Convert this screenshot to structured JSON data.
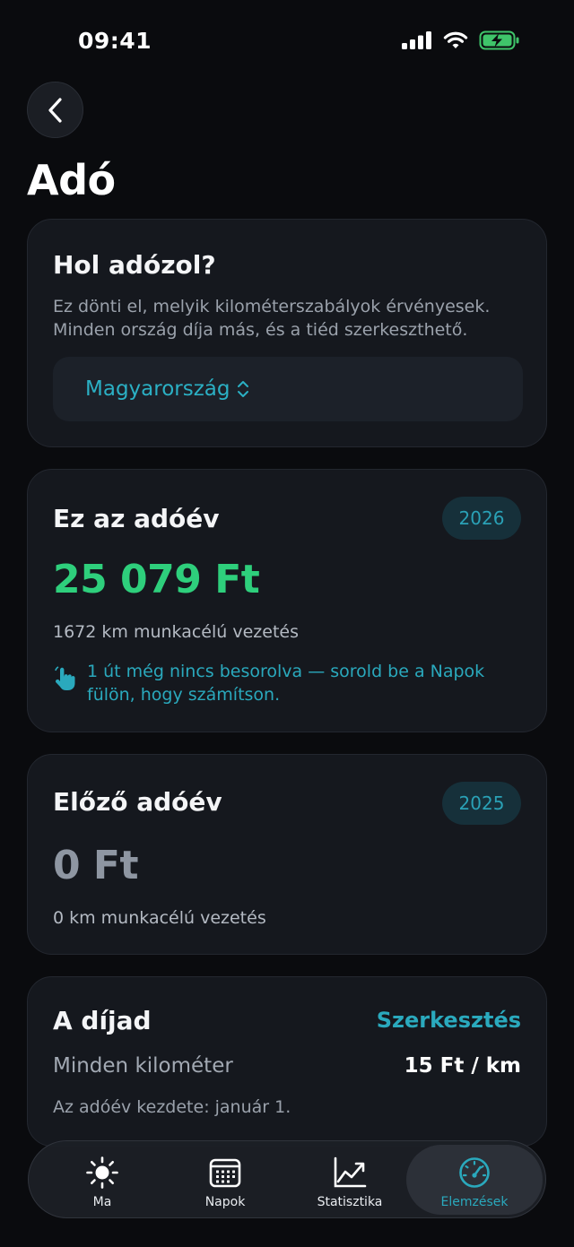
{
  "status_bar": {
    "time": "09:41"
  },
  "page": {
    "title": "Adó"
  },
  "tax_country": {
    "title": "Hol adózol?",
    "description": "Ez dönti el, melyik kilométerszabályok érvényesek. Minden ország díja más, és a tiéd szerkeszthető.",
    "selected_country": "Magyarország"
  },
  "current_year": {
    "title": "Ez az adóév",
    "year": "2026",
    "amount": "25 079 Ft",
    "distance": "1672 km munkacélú vezetés",
    "notice": "1 út még nincs besorolva — sorold be a Napok fülön, hogy számítson."
  },
  "previous_year": {
    "title": "Előző adóév",
    "year": "2025",
    "amount": "0 Ft",
    "distance": "0 km munkacélú vezetés"
  },
  "rate": {
    "title": "A díjad",
    "edit_label": "Szerkesztés",
    "label": "Minden kilométer",
    "value": "15 Ft / km",
    "year_start": "Az adóév kezdete: január 1."
  },
  "tabs": [
    {
      "label": "Ma",
      "icon": "sun-icon"
    },
    {
      "label": "Napok",
      "icon": "calendar-icon"
    },
    {
      "label": "Statisztika",
      "icon": "chart-icon"
    },
    {
      "label": "Elemzések",
      "icon": "gauge-icon",
      "active": true
    }
  ],
  "colors": {
    "accent": "#2aa9bd",
    "positive": "#2ecf7c",
    "muted_amount": "#8e96a2",
    "background": "#0a0b0e",
    "card": "#15181e"
  }
}
